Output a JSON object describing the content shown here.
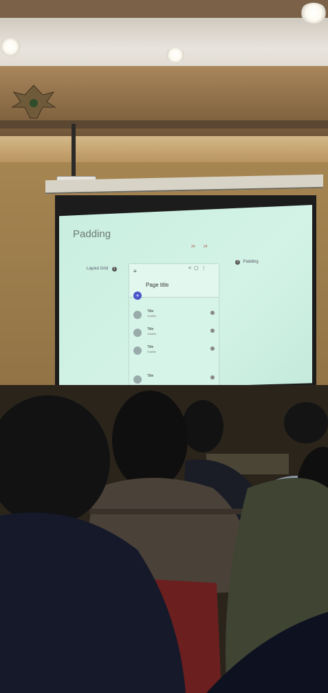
{
  "slide": {
    "title": "Padding",
    "layout_grid_label": "Layout Grid",
    "padding_label": "Padding",
    "badge_1": "1",
    "badge_2": "2",
    "measure_a": "24",
    "measure_b": "24"
  },
  "mockup": {
    "page_title": "Page title",
    "fab_symbol": "+",
    "menu_symbol": "≡",
    "rows": [
      {
        "title": "Title",
        "subtitle": "Subtitle"
      },
      {
        "title": "Title",
        "subtitle": "Subtitle"
      },
      {
        "title": "Title",
        "subtitle": "Subtitle"
      },
      {
        "title": "Title",
        "subtitle": ""
      }
    ]
  },
  "icons": [
    "menu-icon",
    "share-icon",
    "window-icon",
    "more-icon",
    "add-icon",
    "person-icon",
    "info-icon"
  ],
  "colors": {
    "screen": "#cfeee2",
    "fab": "#4a55c9",
    "wall": "#98794a"
  }
}
